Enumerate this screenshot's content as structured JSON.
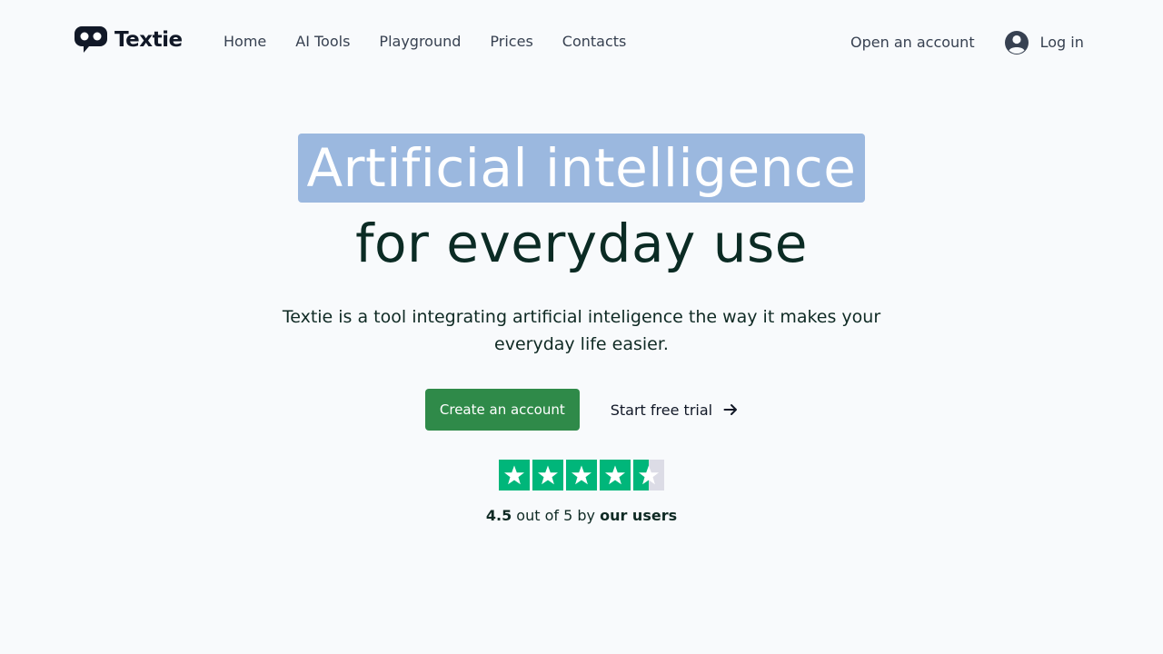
{
  "header": {
    "logo_text": "Textie",
    "nav": [
      {
        "label": "Home"
      },
      {
        "label": "AI Tools"
      },
      {
        "label": "Playground"
      },
      {
        "label": "Prices"
      },
      {
        "label": "Contacts"
      }
    ],
    "open_account": "Open an account",
    "login": "Log in"
  },
  "hero": {
    "headline_highlight": "Artificial intelligence",
    "headline_rest": "for everyday use",
    "subtitle": "Textie is a tool integrating artificial inteligence the way it makes your everyday life easier.",
    "primary_cta": "Create an account",
    "secondary_cta": "Start free trial"
  },
  "rating": {
    "score": "4.5",
    "out_of_text": " out of 5 by ",
    "by_label": "our users",
    "stars_value": 4.5,
    "stars_max": 5
  },
  "colors": {
    "background": "#f8fafc",
    "highlight": "#9bb8df",
    "primary_button": "#2f8a49",
    "star_green": "#00b67a",
    "star_empty": "#dcdce6"
  },
  "icons": [
    "speech-bubble-logo-icon",
    "user-circle-icon",
    "arrow-right-icon",
    "star-icon"
  ]
}
